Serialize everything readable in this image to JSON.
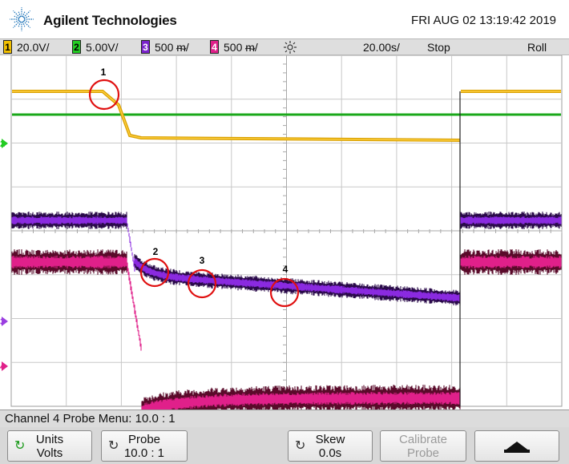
{
  "header": {
    "brand": "Agilent Technologies",
    "datetime": "FRI AUG 02 13:19:42 2019"
  },
  "status_bar": {
    "channels": [
      {
        "num": "1",
        "scale": "20.0V/",
        "color": "#f2c000"
      },
      {
        "num": "2",
        "scale": "5.00V/",
        "color": "#22cc22"
      },
      {
        "num": "3",
        "scale": "500\u0001/",
        "display_scale": "500 ᵯ/",
        "color": "#7a22cc"
      },
      {
        "num": "4",
        "scale": "500\u0001/",
        "display_scale": "500 ᵯ/",
        "color": "#e0208a"
      }
    ],
    "trigger_icon": "sun-trigger-icon",
    "timebase": "20.00s/",
    "run_state": "Stop",
    "mode": "Roll"
  },
  "channel_markers": {
    "ch2": "2",
    "ch3": "3",
    "ch4": "4"
  },
  "annotations": [
    "1",
    "2",
    "3",
    "4"
  ],
  "annotation_color": "#e01010",
  "menu_line": "Channel 4  Probe Menu: 10.0 : 1",
  "softkeys": {
    "units": {
      "title": "Units",
      "value": "Volts"
    },
    "probe": {
      "title": "Probe",
      "value": "10.0 : 1"
    },
    "skew": {
      "title": "Skew",
      "value": "0.0s"
    },
    "calibrate": {
      "title": "Calibrate",
      "value": "Probe"
    }
  }
}
